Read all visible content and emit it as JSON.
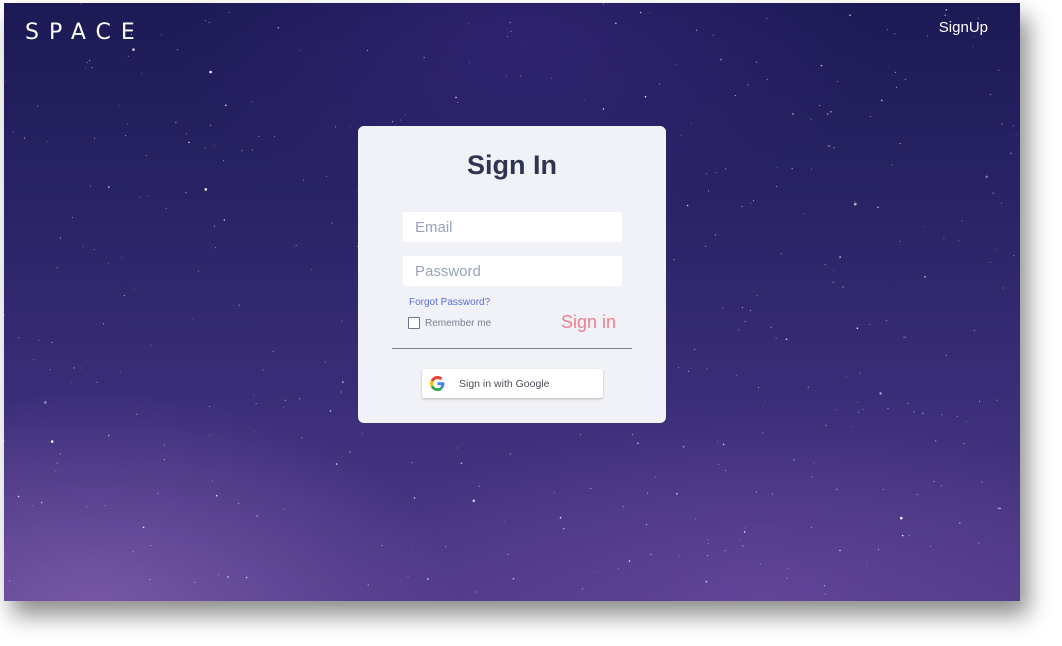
{
  "header": {
    "logo_text": "SPACE",
    "signup_label": "SignUp"
  },
  "signin_card": {
    "title": "Sign In",
    "email_placeholder": "Email",
    "password_placeholder": "Password",
    "forgot_password_label": "Forgot Password?",
    "remember_me_label": "Remember me",
    "remember_me_checked": false,
    "signin_button_label": "Sign in",
    "google_button_label": "Sign in with Google",
    "google_icon": "google-g-icon"
  },
  "colors": {
    "accent_signin": "#ee7f8f",
    "link": "#5a6fd8",
    "title": "#2f3550",
    "card_bg": "#f1f2f7"
  }
}
